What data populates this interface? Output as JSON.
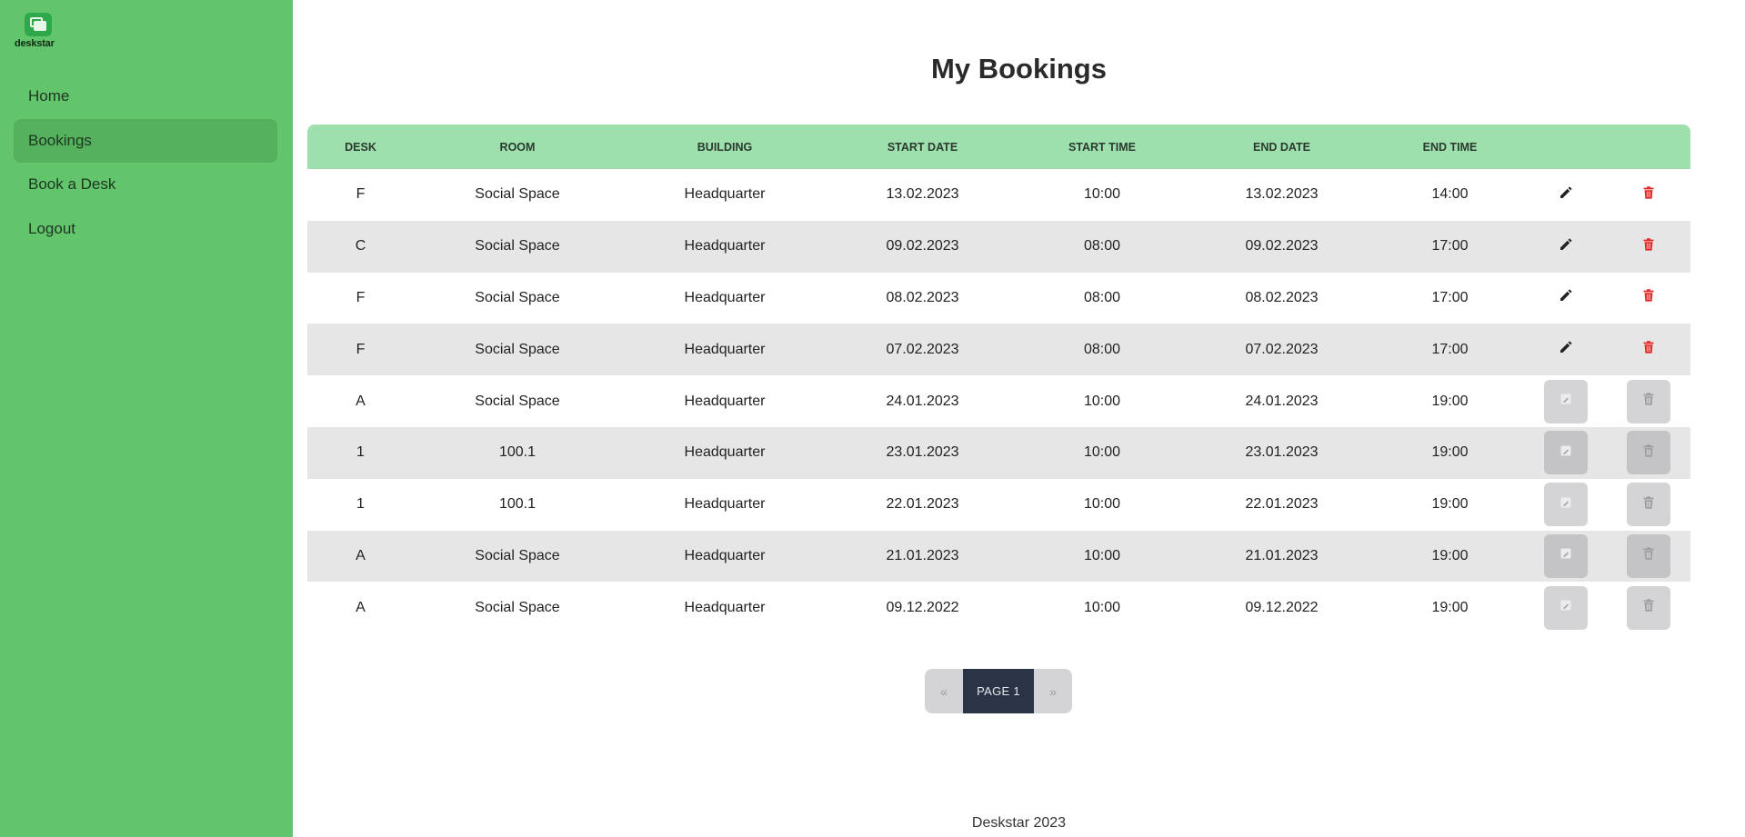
{
  "brand": {
    "name": "deskstar"
  },
  "nav": {
    "items": [
      {
        "label": "Home",
        "active": false
      },
      {
        "label": "Bookings",
        "active": true
      },
      {
        "label": "Book a Desk",
        "active": false
      },
      {
        "label": "Logout",
        "active": false
      }
    ]
  },
  "page": {
    "title": "My Bookings"
  },
  "table": {
    "columns": [
      "DESK",
      "ROOM",
      "BUILDING",
      "START DATE",
      "START TIME",
      "END DATE",
      "END TIME"
    ],
    "rows": [
      {
        "desk": "F",
        "room": "Social Space",
        "building": "Headquarter",
        "start_date": "13.02.2023",
        "start_time": "10:00",
        "end_date": "13.02.2023",
        "end_time": "14:00",
        "editable": true
      },
      {
        "desk": "C",
        "room": "Social Space",
        "building": "Headquarter",
        "start_date": "09.02.2023",
        "start_time": "08:00",
        "end_date": "09.02.2023",
        "end_time": "17:00",
        "editable": true
      },
      {
        "desk": "F",
        "room": "Social Space",
        "building": "Headquarter",
        "start_date": "08.02.2023",
        "start_time": "08:00",
        "end_date": "08.02.2023",
        "end_time": "17:00",
        "editable": true
      },
      {
        "desk": "F",
        "room": "Social Space",
        "building": "Headquarter",
        "start_date": "07.02.2023",
        "start_time": "08:00",
        "end_date": "07.02.2023",
        "end_time": "17:00",
        "editable": true
      },
      {
        "desk": "A",
        "room": "Social Space",
        "building": "Headquarter",
        "start_date": "24.01.2023",
        "start_time": "10:00",
        "end_date": "24.01.2023",
        "end_time": "19:00",
        "editable": false
      },
      {
        "desk": "1",
        "room": "100.1",
        "building": "Headquarter",
        "start_date": "23.01.2023",
        "start_time": "10:00",
        "end_date": "23.01.2023",
        "end_time": "19:00",
        "editable": false
      },
      {
        "desk": "1",
        "room": "100.1",
        "building": "Headquarter",
        "start_date": "22.01.2023",
        "start_time": "10:00",
        "end_date": "22.01.2023",
        "end_time": "19:00",
        "editable": false
      },
      {
        "desk": "A",
        "room": "Social Space",
        "building": "Headquarter",
        "start_date": "21.01.2023",
        "start_time": "10:00",
        "end_date": "21.01.2023",
        "end_time": "19:00",
        "editable": false
      },
      {
        "desk": "A",
        "room": "Social Space",
        "building": "Headquarter",
        "start_date": "09.12.2022",
        "start_time": "10:00",
        "end_date": "09.12.2022",
        "end_time": "19:00",
        "editable": false
      }
    ],
    "icons": {
      "edit": "pencil-icon",
      "delete": "trash-icon"
    }
  },
  "pagination": {
    "prev": "«",
    "current": "PAGE 1",
    "next": "»"
  },
  "footer": {
    "text": "Deskstar 2023"
  },
  "colors": {
    "sidebar": "#62c46b",
    "sidebar_active": "#56b15f",
    "table_header": "#9de0ae",
    "delete_red": "#e02424",
    "pager_current": "#2b3446"
  }
}
